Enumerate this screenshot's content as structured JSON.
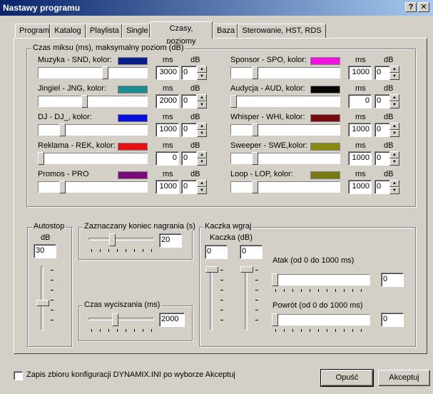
{
  "window": {
    "title": "Nastawy programu",
    "help_glyph": "?",
    "close_glyph": "✕"
  },
  "tabs": [
    "Program",
    "Katalog",
    "Playlista",
    "Single",
    "Czasy, poziomy",
    "Baza",
    "Sterowanie, HST, RDS"
  ],
  "active_tab": "Czasy, poziomy",
  "mix": {
    "title": "Czas miksu (ms), maksymalny poziom  (dB)",
    "unit_ms": "ms",
    "unit_db": "dB",
    "left": [
      {
        "label": "Muzyka - SND,  kolor:",
        "color": "#0a1e8c",
        "ms": "3000",
        "db": "0",
        "slider_pos": 0.62
      },
      {
        "label": "Jingiel - JNG,          kolor:",
        "color": "#1a8c8c",
        "ms": "2000",
        "db": "0",
        "slider_pos": 0.42
      },
      {
        "label": "DJ - DJ_,               kolor:",
        "color": "#0a10e0",
        "ms": "1000",
        "db": "0",
        "slider_pos": 0.21
      },
      {
        "label": "Reklama - REK, kolor:",
        "color": "#e81010",
        "ms": "0",
        "db": "0",
        "slider_pos": 0.0
      },
      {
        "label": "Promos - PRO",
        "color": "#7a0a7a",
        "ms": "1000",
        "db": "0",
        "slider_pos": 0.21
      }
    ],
    "right": [
      {
        "label": "Sponsor - SPO, kolor:",
        "color": "#f010e0",
        "ms": "1000",
        "db": "0",
        "slider_pos": 0.21
      },
      {
        "label": "Audycja - AUD, kolor:",
        "color": "#050505",
        "ms": "0",
        "db": "0",
        "slider_pos": 0.0
      },
      {
        "label": "Whisper - WHI, kolor:",
        "color": "#7a0a10",
        "ms": "1000",
        "db": "0",
        "slider_pos": 0.21
      },
      {
        "label": "Sweeper - SWE,kolor:",
        "color": "#8a8a10",
        "ms": "1000",
        "db": "0",
        "slider_pos": 0.21
      },
      {
        "label": "Loop - LOP,        kolor:",
        "color": "#7a7a10",
        "ms": "1000",
        "db": "0",
        "slider_pos": 0.21
      }
    ]
  },
  "autostop": {
    "title": "Autostop",
    "db_label": "dB",
    "value": "30",
    "slider_pos": 0.58
  },
  "end_marker": {
    "title": "Zaznaczany koniec nagrania (s)",
    "value": "20",
    "slider_pos": 0.35
  },
  "fade": {
    "title": "Czas wyciszania (ms)",
    "value": "2000",
    "slider_pos": 0.4
  },
  "duck": {
    "title": "Kaczka wgraj",
    "kaczka_label": "Kaczka (dB)",
    "value_1": "0",
    "value_2": "0",
    "slider_1_pos": 0.0,
    "slider_2_pos": 0.0,
    "attack_label": "Atak (od 0 do 1000 ms)",
    "attack_value": "0",
    "attack_pos": 0.0,
    "release_label": "Powrót (od 0 do 1000 ms)",
    "release_value": "0",
    "release_pos": 0.0
  },
  "footer": {
    "checkbox_label": "Zapis zbioru konfiguracji DYNAMIX.INI po wyborze Akceptuj",
    "checked": false,
    "cancel_label": "Opuść",
    "accept_label": "Akceptuj"
  }
}
